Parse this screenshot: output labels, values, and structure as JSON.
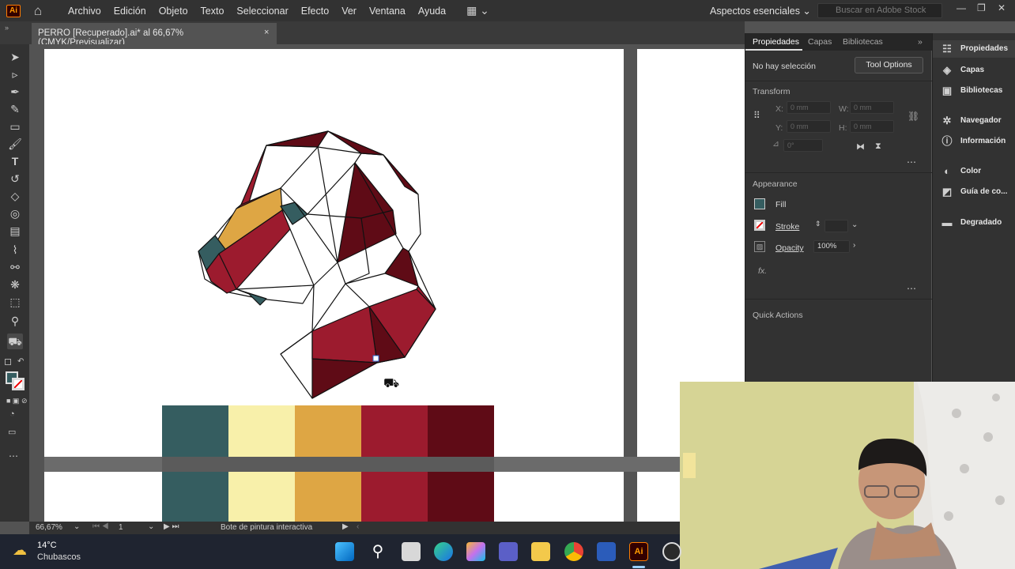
{
  "app": {
    "logo_text": "Ai",
    "menu": [
      "Archivo",
      "Edición",
      "Objeto",
      "Texto",
      "Seleccionar",
      "Efecto",
      "Ver",
      "Ventana",
      "Ayuda"
    ],
    "workspace": "Aspectos esenciales",
    "search_placeholder": "Buscar en Adobe Stock"
  },
  "document": {
    "tab_title": "PERRO [Recuperado].ai* al 66,67% (CMYK/Previsualizar)",
    "close_glyph": "×"
  },
  "status": {
    "zoom": "66,67%",
    "artboard": "1",
    "tool_name": "Bote de pintura interactiva"
  },
  "properties": {
    "tabs": [
      "Propiedades",
      "Capas",
      "Bibliotecas"
    ],
    "no_selection": "No hay selección",
    "tool_options": "Tool Options",
    "transform": "Transform",
    "x_label": "X:",
    "y_label": "Y:",
    "w_label": "W:",
    "h_label": "H:",
    "x_value": "0 mm",
    "y_value": "0 mm",
    "w_value": "0 mm",
    "h_value": "0 mm",
    "angle_value": "0°",
    "appearance": "Appearance",
    "fill": "Fill",
    "stroke": "Stroke",
    "opacity": "Opacity",
    "opacity_value": "100%",
    "fx": "fx.",
    "quick_actions": "Quick Actions"
  },
  "right_panels": [
    "Propiedades",
    "Capas",
    "Bibliotecas",
    "Navegador",
    "Información",
    "Color",
    "Guía de co...",
    "Degradado"
  ],
  "palette": [
    "#355d60",
    "#f8f0aa",
    "#dea644",
    "#9c1b2e",
    "#5f0b16"
  ],
  "taskbar": {
    "weather_temp": "14°C",
    "weather_desc": "Chubascos"
  }
}
